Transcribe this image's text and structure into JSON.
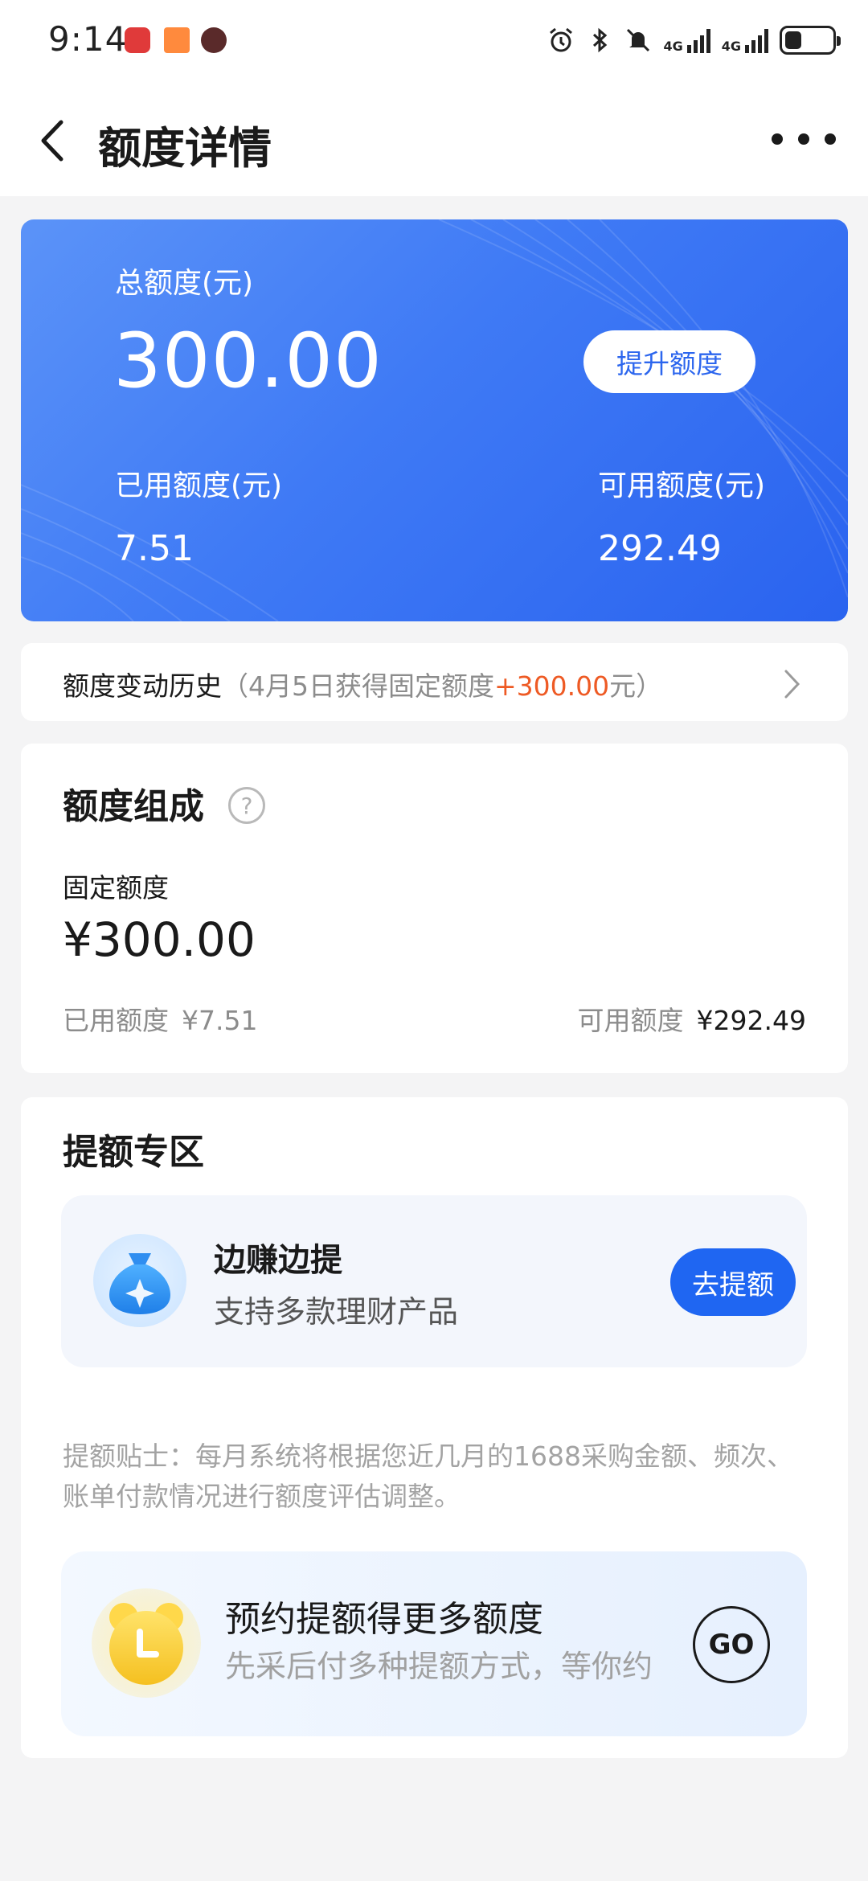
{
  "status_bar": {
    "time": "9:14",
    "sim1_label": "4G",
    "sim2_label": "4G",
    "battery_percent": 35,
    "icons": [
      "alarm-icon",
      "bluetooth-icon",
      "mute-icon",
      "signal-icon",
      "battery-icon"
    ]
  },
  "header": {
    "title": "额度详情"
  },
  "hero": {
    "total_label": "总额度(元)",
    "total_value": "300.00",
    "raise_button": "提升额度",
    "used_label": "已用额度(元)",
    "used_value": "7.51",
    "available_label": "可用额度(元)",
    "available_value": "292.49",
    "gradient_start": "#5b93f8",
    "gradient_end": "#2a63ef"
  },
  "history": {
    "label": "额度变动历史",
    "detail_prefix": "（4月5日获得固定额度",
    "detail_amount": "+300.00",
    "detail_suffix": "元）",
    "amount_color": "#ee5a24"
  },
  "composition": {
    "title": "额度组成",
    "help_symbol": "?",
    "fixed_label": "固定额度",
    "fixed_value": "¥300.00",
    "used_label": "已用额度",
    "used_value": "¥7.51",
    "available_label": "可用额度",
    "available_value": "¥292.49"
  },
  "raise_zone": {
    "title": "提额专区",
    "earn": {
      "title": "边赚边提",
      "subtitle": "支持多款理财产品",
      "button": "去提额",
      "button_color": "#1f66f2"
    },
    "tip": "提额贴士：每月系统将根据您近几月的1688采购金额、频次、账单付款情况进行额度评估调整。",
    "reserve": {
      "title": "预约提额得更多额度",
      "subtitle": "先采后付多种提额方式，等你约",
      "button": "GO"
    }
  }
}
